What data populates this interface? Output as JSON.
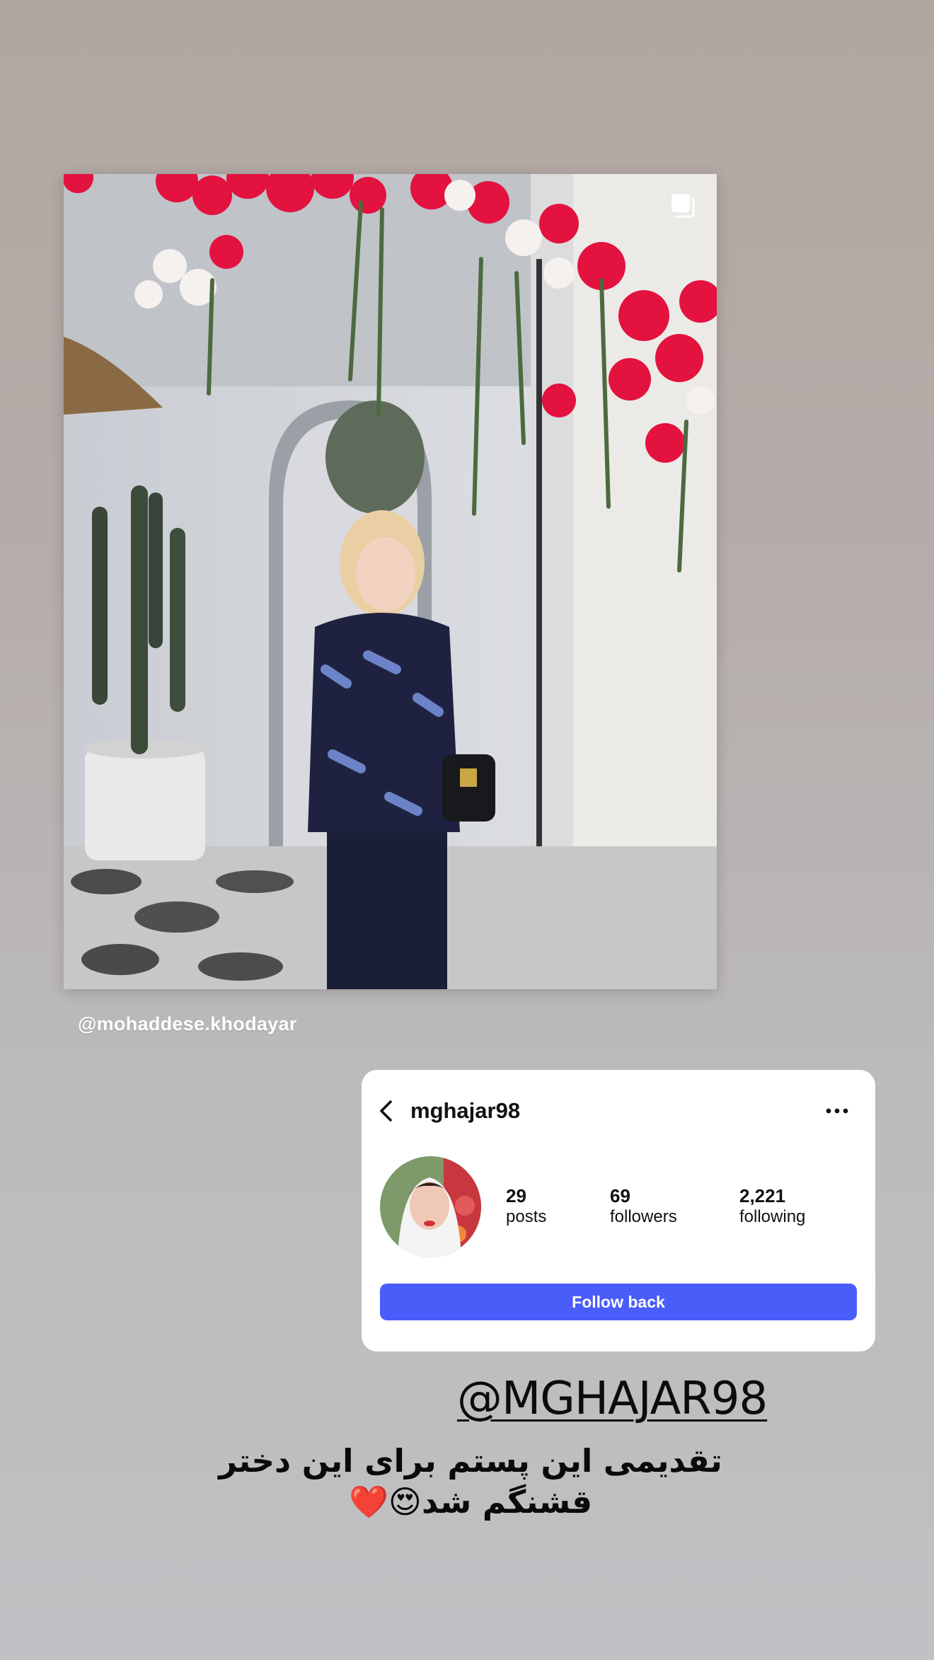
{
  "post": {
    "credit": "@mohaddese.khodayar",
    "multi_icon": "multiple-posts-icon"
  },
  "profile_card": {
    "username": "mghajar98",
    "back_icon": "chevron-left-icon",
    "more_icon": "ellipsis-icon",
    "stats": {
      "posts_count": "29",
      "posts_label": "posts",
      "followers_count": "69",
      "followers_label": "followers",
      "following_count": "2,221",
      "following_label": "following"
    },
    "follow_back_label": "Follow back",
    "accent_color": "#4a5df9"
  },
  "mention": "@MGHAJAR98",
  "caption": {
    "line1": "تقدیمی این پستم برای این دختر",
    "line2": "قشنگم شد😍❤️"
  }
}
